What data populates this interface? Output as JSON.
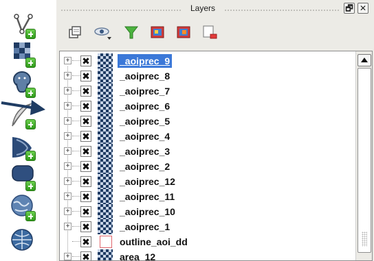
{
  "left_toolbar": {
    "tools": [
      {
        "icon": "add-vector-layer-icon"
      },
      {
        "icon": "add-raster-layer-icon"
      },
      {
        "icon": "add-postgis-layer-icon"
      },
      {
        "icon": "add-spatialite-layer-icon"
      },
      {
        "icon": "add-mssql-layer-icon"
      },
      {
        "icon": "add-oracle-layer-icon"
      },
      {
        "icon": "add-wms-layer-icon"
      },
      {
        "icon": "add-wfs-layer-icon"
      }
    ],
    "pointer": {
      "icon": "arrow-pointer-icon",
      "color": "#1f3c63"
    }
  },
  "layers_panel": {
    "title": "Layers",
    "float_label": "🗗",
    "close_label": "✕",
    "toolbar": [
      {
        "icon": "open-layer-styling-icon"
      },
      {
        "icon": "manage-visibility-icon"
      },
      {
        "icon": "filter-legend-icon"
      },
      {
        "icon": "expand-all-icon"
      },
      {
        "icon": "collapse-all-icon"
      },
      {
        "icon": "remove-layer-icon"
      }
    ],
    "layers": [
      {
        "name": "_aoiprec_9",
        "type": "raster",
        "checked": "✖",
        "expander": "+",
        "selected": true
      },
      {
        "name": "_aoiprec_8",
        "type": "raster",
        "checked": "✖",
        "expander": "+",
        "selected": false
      },
      {
        "name": "_aoiprec_7",
        "type": "raster",
        "checked": "✖",
        "expander": "+",
        "selected": false
      },
      {
        "name": "_aoiprec_6",
        "type": "raster",
        "checked": "✖",
        "expander": "+",
        "selected": false
      },
      {
        "name": "_aoiprec_5",
        "type": "raster",
        "checked": "✖",
        "expander": "+",
        "selected": false
      },
      {
        "name": "_aoiprec_4",
        "type": "raster",
        "checked": "✖",
        "expander": "+",
        "selected": false
      },
      {
        "name": "_aoiprec_3",
        "type": "raster",
        "checked": "✖",
        "expander": "+",
        "selected": false
      },
      {
        "name": "_aoiprec_2",
        "type": "raster",
        "checked": "✖",
        "expander": "+",
        "selected": false
      },
      {
        "name": "_aoiprec_12",
        "type": "raster",
        "checked": "✖",
        "expander": "+",
        "selected": false
      },
      {
        "name": "_aoiprec_11",
        "type": "raster",
        "checked": "✖",
        "expander": "+",
        "selected": false
      },
      {
        "name": "_aoiprec_10",
        "type": "raster",
        "checked": "✖",
        "expander": "+",
        "selected": false
      },
      {
        "name": "_aoiprec_1",
        "type": "raster",
        "checked": "✖",
        "expander": "+",
        "selected": false
      },
      {
        "name": "outline_aoi_dd",
        "type": "vector",
        "checked": "✖",
        "expander": "",
        "selected": false
      },
      {
        "name": "area_12",
        "type": "raster",
        "checked": "✖",
        "expander": "+",
        "selected": false
      }
    ],
    "colors": {
      "selection": "#3b78d8",
      "panel_bg": "#ecebe6"
    }
  }
}
